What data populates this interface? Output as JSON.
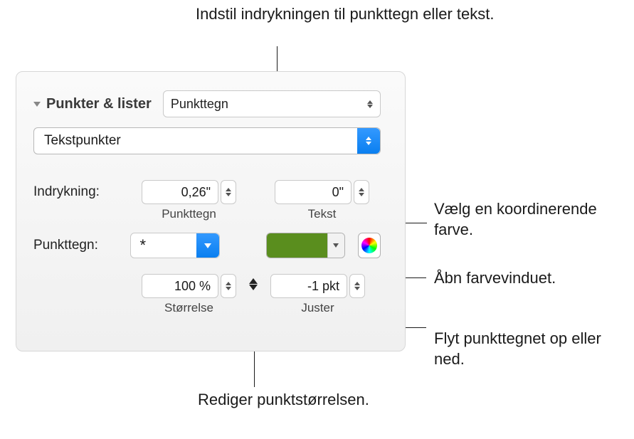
{
  "callouts": {
    "top": "Indstil indrykningen til punkttegn eller tekst.",
    "color_well": "Vælg en koordinerende farve.",
    "color_picker": "Åbn farvevinduet.",
    "align": "Flyt punkttegnet op eller ned.",
    "size": "Rediger punktstørrelsen."
  },
  "section_title": "Punkter & lister",
  "style_popup": "Punkttegn",
  "type_popup": "Tekstpunkter",
  "indent_label": "Indrykning:",
  "indent_bullet": {
    "value": "0,26\"",
    "label": "Punkttegn"
  },
  "indent_text": {
    "value": "0\"",
    "label": "Tekst"
  },
  "bullet_label": "Punkttegn:",
  "bullet_symbol": "*",
  "bullet_color": "#5a8e1e",
  "size": {
    "value": "100 %",
    "label": "Størrelse"
  },
  "align": {
    "value": "-1 pkt",
    "label": "Juster"
  }
}
